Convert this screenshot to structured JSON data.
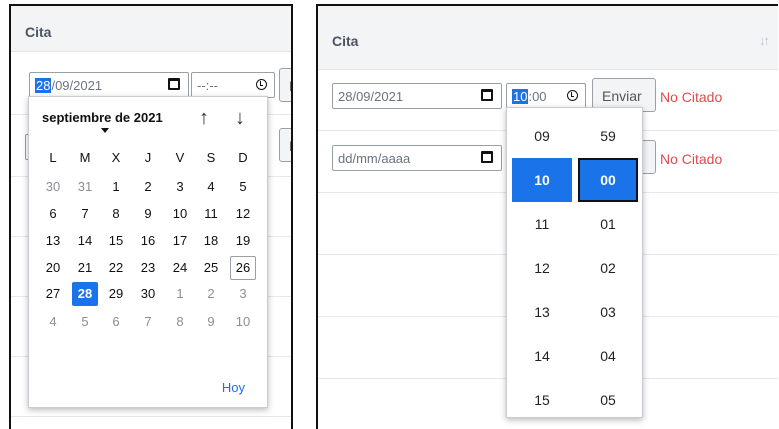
{
  "left_panel": {
    "header": "Cita",
    "date_input": {
      "day": "28",
      "rest": "/09/2021"
    },
    "time_input": {
      "value": "--:--"
    },
    "button_label": "E"
  },
  "calendar": {
    "month_title": "septiembre de 2021",
    "nav_up": "↑",
    "nav_down": "↓",
    "weekdays": [
      "L",
      "M",
      "X",
      "J",
      "V",
      "S",
      "D"
    ],
    "weeks": [
      [
        "30",
        "31",
        "1",
        "2",
        "3",
        "4",
        "5"
      ],
      [
        "6",
        "7",
        "8",
        "9",
        "10",
        "11",
        "12"
      ],
      [
        "13",
        "14",
        "15",
        "16",
        "17",
        "18",
        "19"
      ],
      [
        "20",
        "21",
        "22",
        "23",
        "24",
        "25",
        "26"
      ],
      [
        "27",
        "28",
        "29",
        "30",
        "1",
        "2",
        "3"
      ],
      [
        "4",
        "5",
        "6",
        "7",
        "8",
        "9",
        "10"
      ]
    ],
    "selected_day": "28",
    "today_day": "26",
    "today_label": "Hoy"
  },
  "right_panel": {
    "header": "Cita",
    "sort_icon": "↓↑",
    "rows": [
      {
        "date": "28/09/2021",
        "time_hour": "10",
        "time_rest": ":00",
        "button": "Enviar",
        "status": "No Citado"
      },
      {
        "date": "dd/mm/aaaa",
        "status": "No Citado"
      }
    ]
  },
  "time_picker": {
    "hours": [
      "09",
      "10",
      "11",
      "12",
      "13",
      "14",
      "15"
    ],
    "minutes": [
      "59",
      "00",
      "01",
      "02",
      "03",
      "04",
      "05"
    ],
    "selected_hour": "10",
    "selected_minute": "00"
  },
  "colors": {
    "accent": "#1a73e8",
    "status": "#e5484d"
  }
}
